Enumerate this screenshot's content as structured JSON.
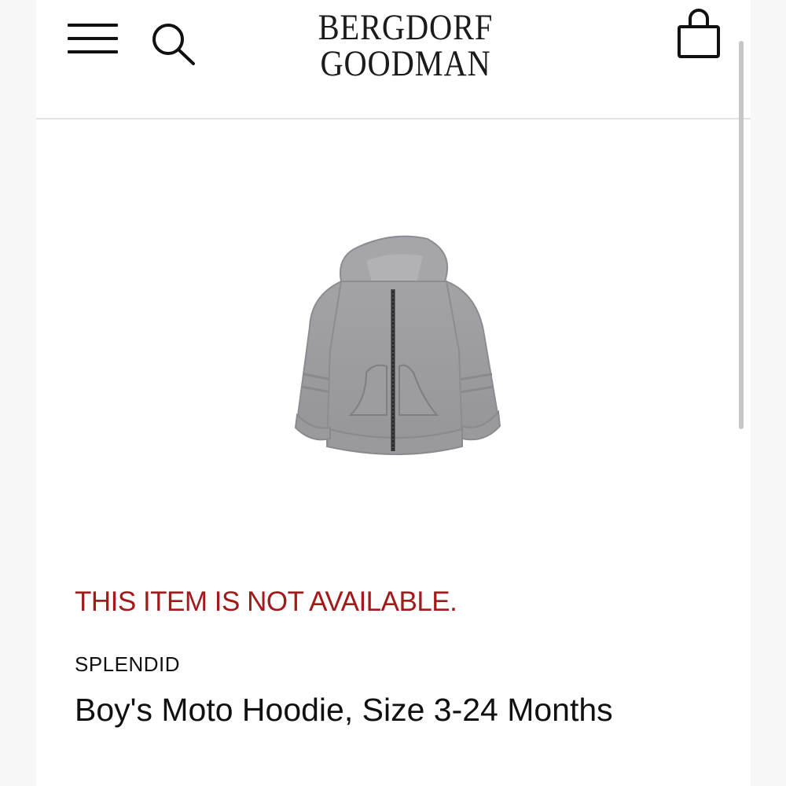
{
  "header": {
    "logo_line1": "BERGDORF",
    "logo_line2": "GOODMAN",
    "menu_icon": "hamburger-menu-icon",
    "search_icon": "search-icon",
    "bag_icon": "shopping-bag-icon"
  },
  "product": {
    "image_icon": "gray-zip-hoodie-image",
    "availability": "THIS ITEM IS NOT AVAILABLE.",
    "brand": "SPLENDID",
    "name": "Boy's Moto Hoodie, Size 3-24 Months"
  },
  "colors": {
    "availability_red": "#a31a1a",
    "text": "#111111",
    "hoodie_gray": "#9c9ca0",
    "divider": "#e2e2e2"
  }
}
